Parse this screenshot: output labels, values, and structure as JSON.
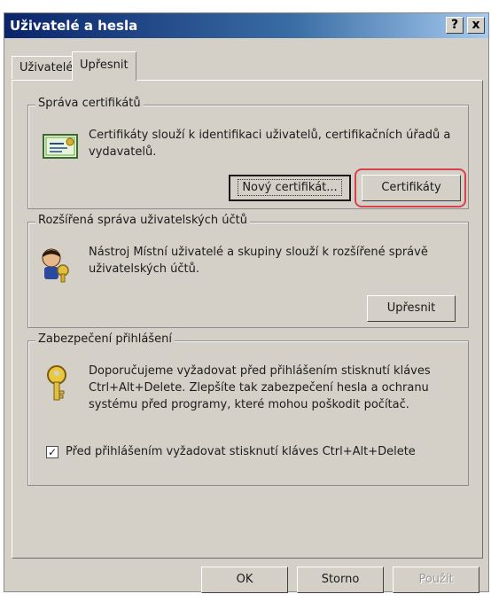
{
  "window": {
    "title": "Uživatelé a hesla"
  },
  "titlebar": {
    "help_label": "?",
    "close_label": "x"
  },
  "tabs": [
    {
      "label": "Uživatelé"
    },
    {
      "label": "Upřesnit"
    }
  ],
  "groups": {
    "certificates": {
      "title": "Správa certifikátů",
      "description": "Certifikáty slouží k identifikaci uživatelů, certifikačních úřadů a vydavatelů.",
      "new_cert_button": "Nový certifikát...",
      "certs_button": "Certifikáty"
    },
    "advanced_users": {
      "title": "Rozšířená správa uživatelských účtů",
      "description": "Nástroj Místní uživatelé a skupiny slouží k rozšířené správě uživatelských účtů.",
      "advanced_button": "Upřesnit"
    },
    "secure_logon": {
      "title": "Zabezpečení přihlášení",
      "description": "Doporučujeme vyžadovat před přihlášením stisknutí kláves Ctrl+Alt+Delete. Zlepšíte tak zabezpečení hesla a ochranu systému před programy, které mohou poškodit počítač.",
      "checkbox_label": "Před přihlášením vyžadovat stisknutí kláves Ctrl+Alt+Delete",
      "checkbox_checked": true
    }
  },
  "footer": {
    "ok_label": "OK",
    "cancel_label": "Storno",
    "apply_label": "Použít"
  },
  "colors": {
    "highlight": "#d8424a",
    "titlebar_start": "#0a246a",
    "titlebar_end": "#a6caf0",
    "dialog_bg": "#d4d0c8"
  }
}
